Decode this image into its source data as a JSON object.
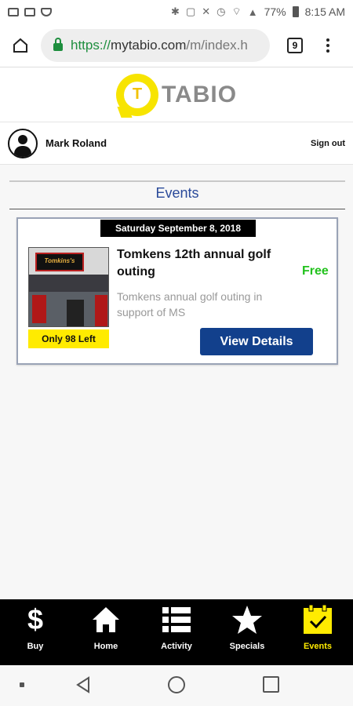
{
  "status_bar": {
    "battery": "77%",
    "time": "8:15 AM"
  },
  "browser": {
    "url_scheme": "https://",
    "url_host": "mytabio.com",
    "url_path": "/m/index.h",
    "tab_count": "9"
  },
  "brand": {
    "logo_letter": "T",
    "logo_text": "TABIO",
    "logo_color": "#f7e400"
  },
  "user": {
    "name": "Mark Roland",
    "sign_out": "Sign out"
  },
  "events": {
    "title": "Events",
    "items": [
      {
        "date": "Saturday September 8, 2018",
        "name": "Tomkens 12th annual golf outing",
        "price": "Free",
        "description": "Tomkens annual golf outing in support of MS",
        "remaining": "Only 98 Left",
        "details_label": "View Details",
        "image_sign": "Tomkins's"
      }
    ]
  },
  "tabs": [
    {
      "label": "Buy",
      "icon": "dollar-icon"
    },
    {
      "label": "Home",
      "icon": "home-icon"
    },
    {
      "label": "Activity",
      "icon": "list-icon"
    },
    {
      "label": "Specials",
      "icon": "star-icon"
    },
    {
      "label": "Events",
      "icon": "calendar-check-icon"
    }
  ],
  "colors": {
    "accent_yellow": "#ffeb00",
    "button_blue": "#12408c",
    "price_green": "#22c21d",
    "events_title": "#2a4a9a"
  }
}
